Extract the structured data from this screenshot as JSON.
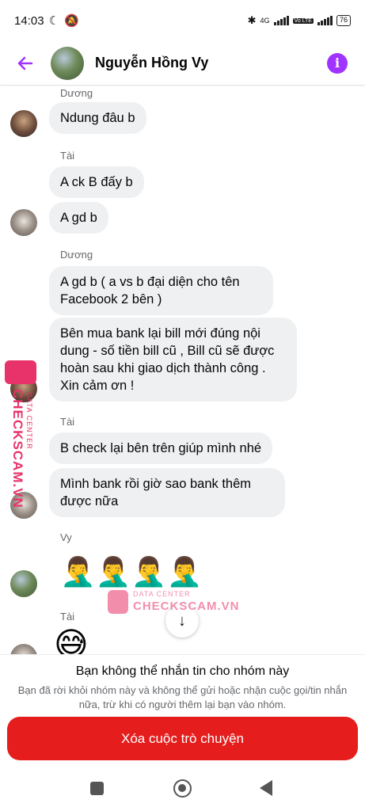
{
  "status_bar": {
    "time": "14:03",
    "network": "4G",
    "volte": "Vo LTE",
    "battery": "76"
  },
  "header": {
    "title": "Nguyễn Hồng Vy"
  },
  "chat": {
    "messages": [
      {
        "sender": "Dương",
        "text": "Ndung đâu b"
      },
      {
        "sender": "Tài",
        "text": "A ck B đấy b"
      },
      {
        "text": "A gd b"
      },
      {
        "sender": "Dương",
        "text": "A gd b ( a vs b đại diện cho tên Facebook 2 bên )"
      },
      {
        "text": "Bên mua bank lại bill mới đúng nội dung - số tiền bill cũ , Bill cũ sẽ được hoàn sau khi giao dịch thành công . Xin cảm ơn !"
      },
      {
        "sender": "Tài",
        "text": "B check lại bên trên giúp mình nhé"
      },
      {
        "text": "Mình bank rồi giờ sao bank thêm được nữa"
      },
      {
        "sender": "Vy",
        "text": "🤦‍♂️🤦‍♂️🤦‍♂️🤦‍♂️"
      },
      {
        "sender": "Tài",
        "text": "😅"
      }
    ]
  },
  "watermark": {
    "sub": "DATA CENTER",
    "brand": "CHECKSCAM.VN"
  },
  "footer": {
    "title": "Bạn không thể nhắn tin cho nhóm này",
    "description": "Bạn đã rời khỏi nhóm này và không thể gửi hoặc nhận cuộc gọi/tin nhắn nữa, trừ khi có người thêm lại bạn vào nhóm.",
    "delete_button": "Xóa cuộc trò chuyện"
  },
  "icons": {
    "back": "back-arrow-icon",
    "info": "info-icon",
    "scroll_down": "arrow-down-icon"
  },
  "colors": {
    "accent": "#a033ff",
    "bubble": "#eff0f2",
    "danger": "#e51d1d",
    "watermark": "#e8336a"
  }
}
